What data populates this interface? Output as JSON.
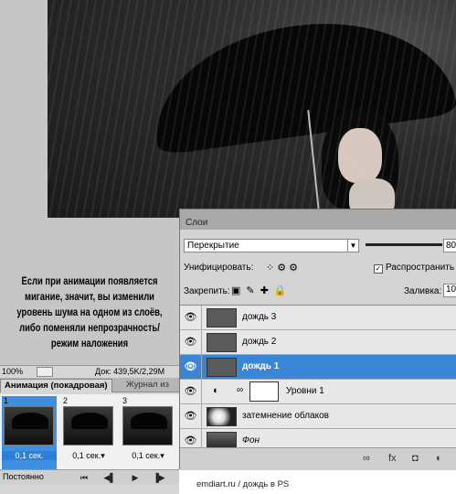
{
  "note": "Если при анимации появляется мигание, значит, вы изменили уровень шума на одном из слоёв, либо поменяли непрозрачность/режим наложения",
  "status": {
    "zoom": "100%",
    "doc": "Док: 439,5K/2,29M"
  },
  "animation": {
    "tabs": [
      "Анимация (покадровая)",
      "Журнал из"
    ],
    "frames": [
      {
        "num": "1",
        "delay": "0,1 сек.",
        "selected": true
      },
      {
        "num": "2",
        "delay": "0,1 сек.▾",
        "selected": false
      },
      {
        "num": "3",
        "delay": "0,1 сек.▾",
        "selected": false
      }
    ],
    "loop": "Постоянно",
    "controls": {
      "first": "⏮",
      "prev": "◀▌",
      "play": "▶",
      "next": "▐▶",
      "tween": "∞",
      "newframe": "⬚",
      "delete": "🗑"
    }
  },
  "layers": {
    "title": "Слои",
    "blend_mode": "Перекрытие",
    "opacity": "80",
    "unify_label": "Унифицировать:",
    "propagate_label": "Распространить",
    "lock_label": "Закрепить:",
    "fill_label": "Заливка:",
    "fill_value": "10",
    "rows": [
      {
        "name": "дождь 3",
        "type": "layer"
      },
      {
        "name": "дождь 2",
        "type": "layer"
      },
      {
        "name": "дождь 1",
        "type": "layer",
        "selected": true
      },
      {
        "name": "Уровни 1",
        "type": "adjustment"
      },
      {
        "name": "затемнение облаков",
        "type": "clouds"
      },
      {
        "name": "Фон",
        "type": "background"
      }
    ],
    "footer_icons": [
      "link-icon",
      "fx-icon",
      "mask-icon",
      "adjustment-icon"
    ]
  },
  "caption": "emdiart.ru  /  дождь в PS"
}
